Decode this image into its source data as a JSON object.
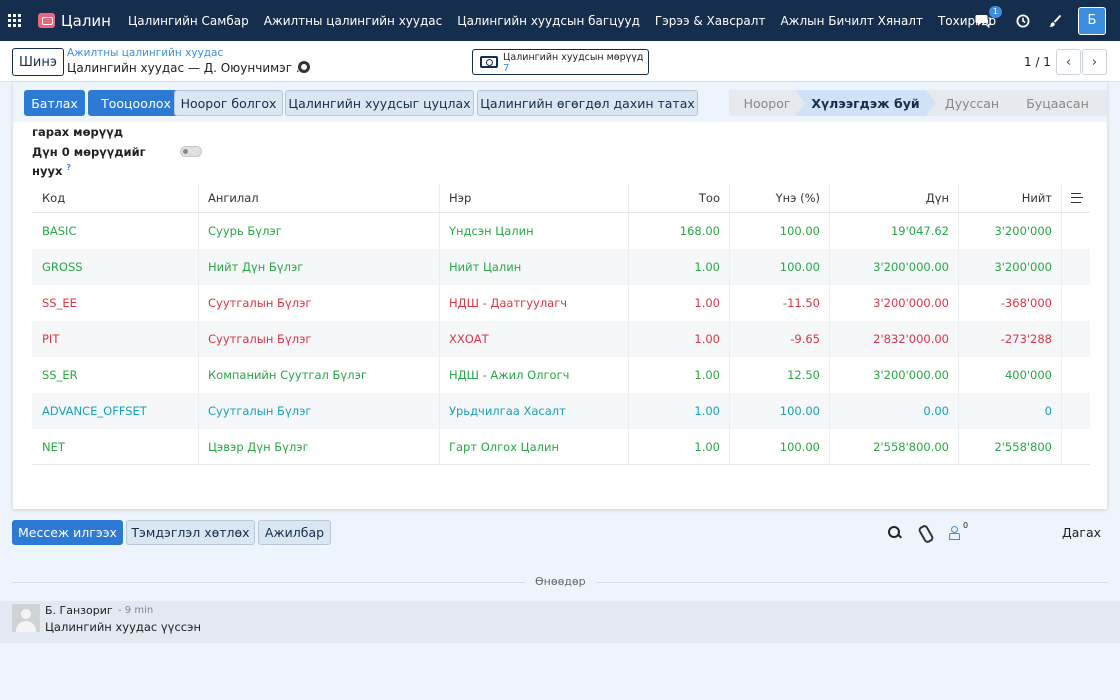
{
  "nav": {
    "brand": "Цалин",
    "menu": [
      "Цалингийн Самбар",
      "Ажилтны цалингийн хуудас",
      "Цалингийн хуудсын багцууд",
      "Гэрээ & Хавсралт",
      "Ажлын Бичилт Хяналт",
      "Тохиргоо"
    ],
    "chat_badge": "1",
    "avatar_letter": "Б"
  },
  "control": {
    "new_label": "Шинэ",
    "breadcrumb_parent": "Ажилтны цалингийн хуудас",
    "breadcrumb_current": "Цалингийн хуудас — Д. Оюунчимэг ...",
    "smart_button_label": "Цалингийн хуудсын мөрүүд",
    "smart_button_count": "7",
    "pager": "1 / 1"
  },
  "actions": [
    "Батлах",
    "Тооцоолох",
    "Ноорог болгох",
    "Цалингийн хуудсыг цуцлах",
    "Цалингийн өгөгдөл дахин татах"
  ],
  "stages": [
    "Ноорог",
    "Хүлээгдэж буй",
    "Дууссан",
    "Буцаасан"
  ],
  "fields": {
    "label_1": "гарах мөрүүд",
    "label_2": "Дүн 0 мөрүүдийг нуух",
    "help": "?"
  },
  "table": {
    "headers": [
      "Код",
      "Ангилал",
      "Нэр",
      "Тоо",
      "Үнэ (%)",
      "Дүн",
      "Нийт"
    ],
    "rows": [
      {
        "code": "BASIC",
        "category": "Суурь Бүлэг",
        "name": "Үндсэн Цалин",
        "qty": "168.00",
        "rate": "100.00",
        "amount": "19'047.62",
        "total": "3'200'000"
      },
      {
        "code": "GROSS",
        "category": "Нийт Дүн Бүлэг",
        "name": "Нийт Цалин",
        "qty": "1.00",
        "rate": "100.00",
        "amount": "3'200'000.00",
        "total": "3'200'000"
      },
      {
        "code": "SS_EE",
        "category": "Суутгалын Бүлэг",
        "name": "НДШ - Даатгуулагч",
        "qty": "1.00",
        "rate": "-11.50",
        "amount": "3'200'000.00",
        "total": "-368'000"
      },
      {
        "code": "PIT",
        "category": "Суутгалын Бүлэг",
        "name": "ХХОАТ",
        "qty": "1.00",
        "rate": "-9.65",
        "amount": "2'832'000.00",
        "total": "-273'288"
      },
      {
        "code": "SS_ER",
        "category": "Компанийн Суутгал Бүлэг",
        "name": "НДШ - Ажил Олгогч",
        "qty": "1.00",
        "rate": "12.50",
        "amount": "3'200'000.00",
        "total": "400'000"
      },
      {
        "code": "ADVANCE_OFFSET",
        "category": "Суутгалын Бүлэг",
        "name": "Урьдчилгаа Хасалт",
        "qty": "1.00",
        "rate": "100.00",
        "amount": "0.00",
        "total": "0"
      },
      {
        "code": "NET",
        "category": "Цэвэр Дүн Бүлэг",
        "name": "Гарт Олгох Цалин",
        "qty": "1.00",
        "rate": "100.00",
        "amount": "2'558'800.00",
        "total": "2'558'800"
      }
    ]
  },
  "chatter": {
    "send_message": "Мессеж илгээх",
    "log_note": "Тэмдэглэл хөтлөх",
    "activity": "Ажилбар",
    "followers_count": "0",
    "follow_label": "Дагах",
    "day_label": "Өнөөдөр",
    "message": {
      "author": "Б. Ганзориг",
      "time": "- 9 min",
      "body": "Цалингийн хуудас үүссэн"
    }
  },
  "colors": {
    "nav_bg": "#152e4d",
    "primary": "#2d7ad4",
    "positive": "#28a745",
    "negative": "#dc3545",
    "info": "#17a2b8"
  }
}
